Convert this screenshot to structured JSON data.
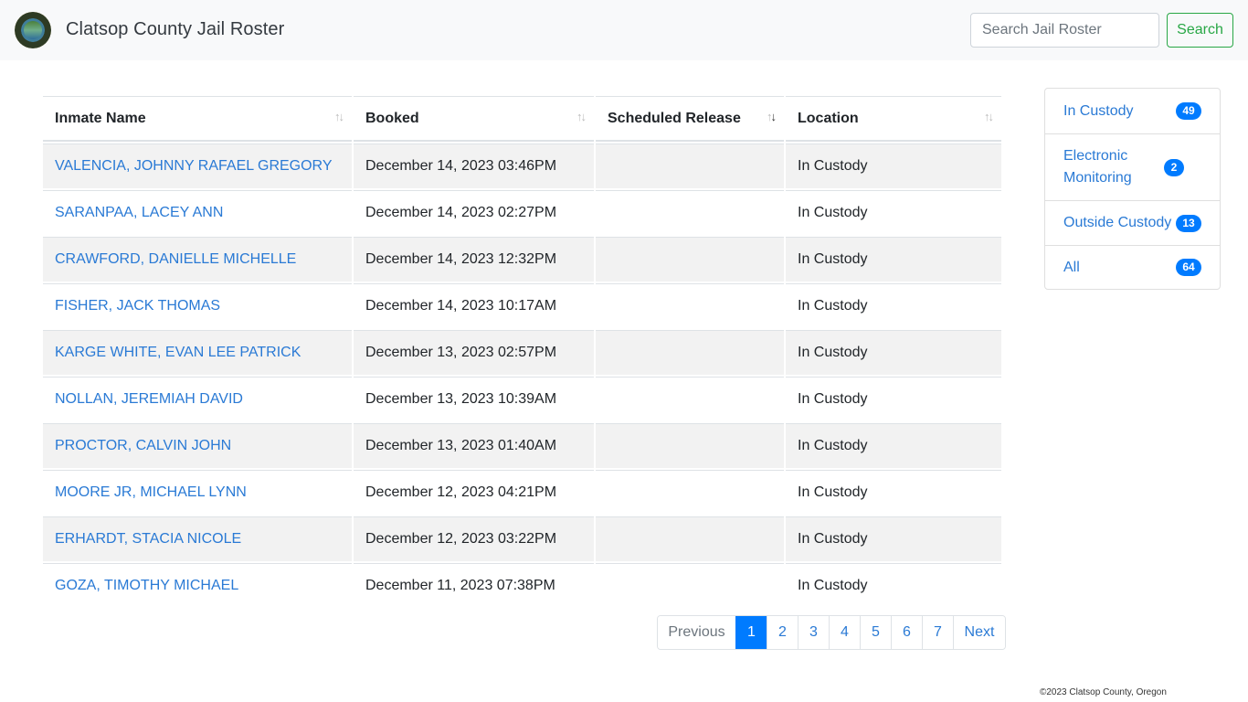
{
  "header": {
    "title": "Clatsop County Jail Roster",
    "logo_icon": "county-seal-logo",
    "search_placeholder": "Search Jail Roster",
    "search_value": "",
    "search_button": "Search"
  },
  "table": {
    "columns": [
      {
        "label": "Inmate Name",
        "sort": "none"
      },
      {
        "label": "Booked",
        "sort": "none"
      },
      {
        "label": "Scheduled Release",
        "sort": "descending"
      },
      {
        "label": "Location",
        "sort": "none"
      }
    ],
    "sort_icon": "sort-arrows-icon",
    "rows": [
      {
        "name": "VALENCIA, JOHNNY RAFAEL GREGORY",
        "booked": "December 14, 2023 03:46PM",
        "release": "",
        "location": "In Custody"
      },
      {
        "name": "SARANPAA, LACEY ANN",
        "booked": "December 14, 2023 02:27PM",
        "release": "",
        "location": "In Custody"
      },
      {
        "name": "CRAWFORD, DANIELLE MICHELLE",
        "booked": "December 14, 2023 12:32PM",
        "release": "",
        "location": "In Custody"
      },
      {
        "name": "FISHER, JACK THOMAS",
        "booked": "December 14, 2023 10:17AM",
        "release": "",
        "location": "In Custody"
      },
      {
        "name": "KARGE WHITE, EVAN LEE PATRICK",
        "booked": "December 13, 2023 02:57PM",
        "release": "",
        "location": "In Custody"
      },
      {
        "name": "NOLLAN, JEREMIAH DAVID",
        "booked": "December 13, 2023 10:39AM",
        "release": "",
        "location": "In Custody"
      },
      {
        "name": "PROCTOR, CALVIN JOHN",
        "booked": "December 13, 2023 01:40AM",
        "release": "",
        "location": "In Custody"
      },
      {
        "name": "MOORE JR, MICHAEL LYNN",
        "booked": "December 12, 2023 04:21PM",
        "release": "",
        "location": "In Custody"
      },
      {
        "name": "ERHARDT, STACIA NICOLE",
        "booked": "December 12, 2023 03:22PM",
        "release": "",
        "location": "In Custody"
      },
      {
        "name": "GOZA, TIMOTHY MICHAEL",
        "booked": "December 11, 2023 07:38PM",
        "release": "",
        "location": "In Custody"
      }
    ]
  },
  "pagination": {
    "previous": "Previous",
    "next": "Next",
    "pages": [
      "1",
      "2",
      "3",
      "4",
      "5",
      "6",
      "7"
    ],
    "current": "1"
  },
  "sidebar": {
    "items": [
      {
        "label": "In Custody",
        "count": "49"
      },
      {
        "label": "Electronic Monitoring",
        "count": "2"
      },
      {
        "label": "Outside Custody",
        "count": "13"
      },
      {
        "label": "All",
        "count": "64"
      }
    ]
  },
  "footer": {
    "copyright": "©2023 Clatsop County, Oregon"
  },
  "colors": {
    "link": "#2a7ad5",
    "primary": "#007bff",
    "success": "#28a745",
    "navbar_bg": "#f8f9fa",
    "stripe": "#f2f2f2"
  }
}
